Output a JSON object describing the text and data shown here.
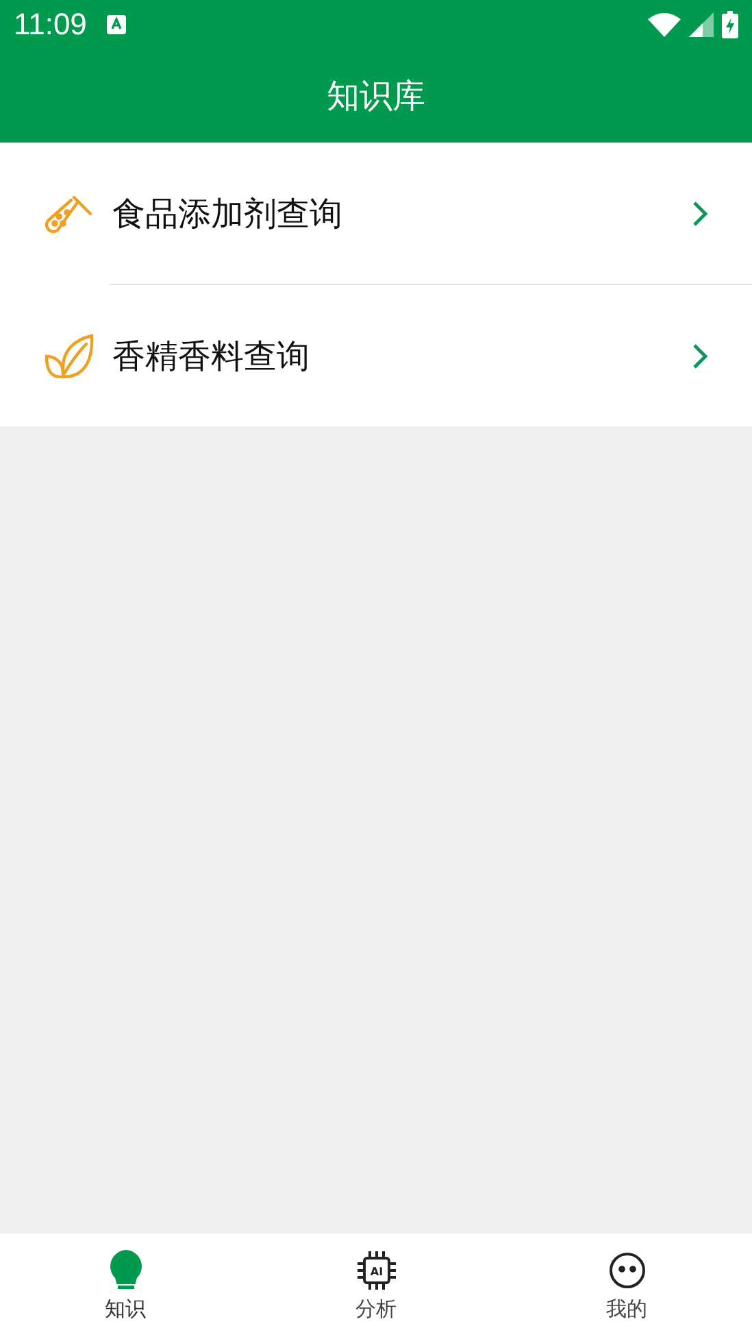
{
  "status_bar": {
    "time": "11:09"
  },
  "title": "知识库",
  "menu": [
    {
      "label": "食品添加剂查询",
      "kind": "tube"
    },
    {
      "label": "香精香料查询",
      "kind": "leaf"
    }
  ],
  "tabs": [
    {
      "label": "知识",
      "kind": "bulb",
      "selected": true
    },
    {
      "label": "分析",
      "kind": "chip",
      "icon_text": "AI",
      "selected": false
    },
    {
      "label": "我的",
      "kind": "face",
      "selected": false
    }
  ]
}
